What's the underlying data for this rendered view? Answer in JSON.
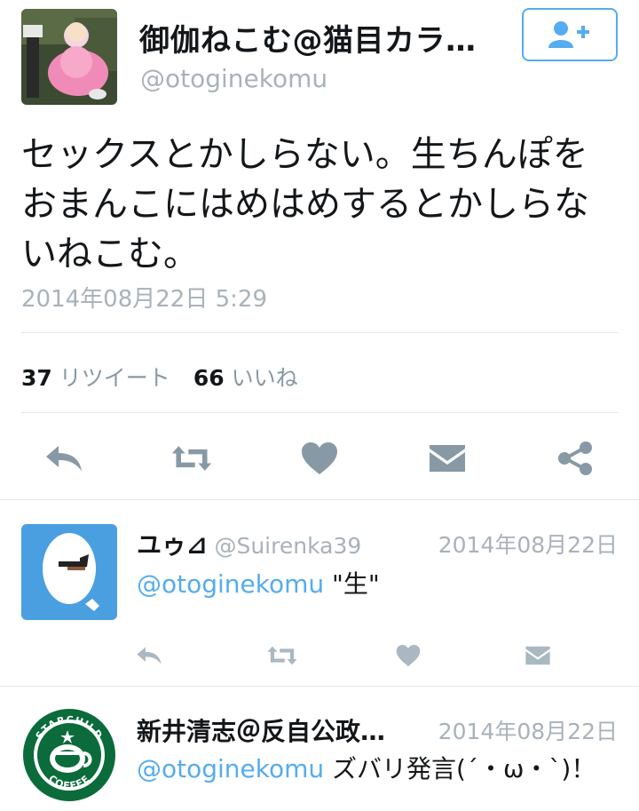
{
  "tweet": {
    "display_name": "御伽ねこむ@猫目カラ…",
    "screen_name": "@otoginekomu",
    "text": "セックスとかしらない。生ちんぽをおまんこにはめはめするとかしらないねこむ。",
    "timestamp": "2014年08月22日 5:29",
    "retweet_count": "37",
    "retweet_label": "リツイート",
    "like_count": "66",
    "like_label": "いいね"
  },
  "actions": [
    "reply-icon",
    "retweet-icon",
    "heart-icon",
    "dm-icon",
    "share-icon"
  ],
  "replies": [
    {
      "name": "ユゥ⊿",
      "handle": "@Suirenka39",
      "date": "2014年08月22日",
      "mention": "@otoginekomu",
      "text": " \"生\""
    },
    {
      "name": "新井清志＠反自公政…",
      "handle": "",
      "date": "2014年08月22日",
      "mention": "@otoginekomu",
      "text": " ズバリ発言(´・ω・`)！"
    }
  ],
  "logo": {
    "top_text": "STARCHILD",
    "bottom_text": "COFFEE"
  },
  "colors": {
    "accent": "#55acee",
    "icon_gray": "#8899a6",
    "reply_icon_gray": "#aab8c2"
  }
}
